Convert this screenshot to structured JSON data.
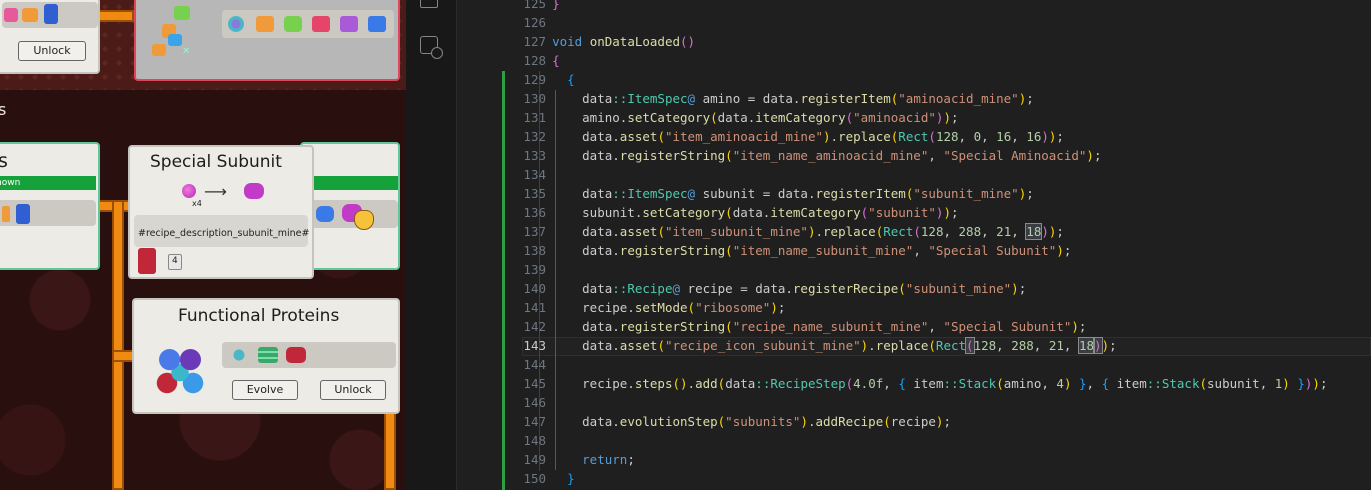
{
  "game": {
    "top_card": {
      "unlock_label": "Unlock"
    },
    "left_header_fragment": "s",
    "left_card": {
      "title_fragment": "s",
      "status_fragment": "nown"
    },
    "special_card": {
      "title": "Special Subunit",
      "multiplier": "x4",
      "description": "#recipe_description_subunit_mine#",
      "stack_count": "4"
    },
    "right_card": {
      "status_fragment": "n"
    },
    "functional_card": {
      "title": "Functional Proteins",
      "evolve_label": "Evolve",
      "unlock_label": "Unlock"
    }
  },
  "editor": {
    "current_line": 143,
    "lines": [
      {
        "n": 125,
        "tokens": [
          [
            "p",
            "  "
          ],
          [
            "b2",
            "}"
          ]
        ]
      },
      {
        "n": 126,
        "tokens": []
      },
      {
        "n": 127,
        "tokens": [
          [
            "p",
            "  "
          ],
          [
            "k",
            "void"
          ],
          [
            "p",
            " "
          ],
          [
            "f",
            "onDataLoaded"
          ],
          [
            "b2",
            "()"
          ]
        ]
      },
      {
        "n": 128,
        "tokens": [
          [
            "p",
            "  "
          ],
          [
            "b2",
            "{"
          ]
        ]
      },
      {
        "n": 129,
        "tokens": [
          [
            "p",
            "    "
          ],
          [
            "b3",
            "{"
          ]
        ]
      },
      {
        "n": 130,
        "tokens": [
          [
            "p",
            "      data"
          ],
          [
            "t",
            "::"
          ],
          [
            "t",
            "ItemSpec"
          ],
          [
            "k",
            "@"
          ],
          [
            "p",
            " amino = data."
          ],
          [
            "f",
            "registerItem"
          ],
          [
            "b1",
            "("
          ],
          [
            "s",
            "\"aminoacid_mine\""
          ],
          [
            "b1",
            ")"
          ],
          [
            "p",
            ";"
          ]
        ]
      },
      {
        "n": 131,
        "tokens": [
          [
            "p",
            "      amino."
          ],
          [
            "f",
            "setCategory"
          ],
          [
            "b1",
            "("
          ],
          [
            "p",
            "data."
          ],
          [
            "f",
            "itemCategory"
          ],
          [
            "b2",
            "("
          ],
          [
            "s",
            "\"aminoacid\""
          ],
          [
            "b2",
            ")"
          ],
          [
            "b1",
            ")"
          ],
          [
            "p",
            ";"
          ]
        ]
      },
      {
        "n": 132,
        "tokens": [
          [
            "p",
            "      data."
          ],
          [
            "f",
            "asset"
          ],
          [
            "b1",
            "("
          ],
          [
            "s",
            "\"item_aminoacid_mine\""
          ],
          [
            "b1",
            ")"
          ],
          [
            "p",
            "."
          ],
          [
            "f",
            "replace"
          ],
          [
            "b1",
            "("
          ],
          [
            "t",
            "Rect"
          ],
          [
            "b2",
            "("
          ],
          [
            "n",
            "128"
          ],
          [
            "p",
            ", "
          ],
          [
            "n",
            "0"
          ],
          [
            "p",
            ", "
          ],
          [
            "n",
            "16"
          ],
          [
            "p",
            ", "
          ],
          [
            "n",
            "16"
          ],
          [
            "b2",
            ")"
          ],
          [
            "b1",
            ")"
          ],
          [
            "p",
            ";"
          ]
        ]
      },
      {
        "n": 133,
        "tokens": [
          [
            "p",
            "      data."
          ],
          [
            "f",
            "registerString"
          ],
          [
            "b1",
            "("
          ],
          [
            "s",
            "\"item_name_aminoacid_mine\""
          ],
          [
            "p",
            ", "
          ],
          [
            "s",
            "\"Special Aminoacid\""
          ],
          [
            "b1",
            ")"
          ],
          [
            "p",
            ";"
          ]
        ]
      },
      {
        "n": 134,
        "tokens": []
      },
      {
        "n": 135,
        "tokens": [
          [
            "p",
            "      data"
          ],
          [
            "t",
            "::"
          ],
          [
            "t",
            "ItemSpec"
          ],
          [
            "k",
            "@"
          ],
          [
            "p",
            " subunit = data."
          ],
          [
            "f",
            "registerItem"
          ],
          [
            "b1",
            "("
          ],
          [
            "s",
            "\"subunit_mine\""
          ],
          [
            "b1",
            ")"
          ],
          [
            "p",
            ";"
          ]
        ]
      },
      {
        "n": 136,
        "tokens": [
          [
            "p",
            "      subunit."
          ],
          [
            "f",
            "setCategory"
          ],
          [
            "b1",
            "("
          ],
          [
            "p",
            "data."
          ],
          [
            "f",
            "itemCategory"
          ],
          [
            "b2",
            "("
          ],
          [
            "s",
            "\"subunit\""
          ],
          [
            "b2",
            ")"
          ],
          [
            "b1",
            ")"
          ],
          [
            "p",
            ";"
          ]
        ]
      },
      {
        "n": 137,
        "tokens": [
          [
            "p",
            "      data."
          ],
          [
            "f",
            "asset"
          ],
          [
            "b1",
            "("
          ],
          [
            "s",
            "\"item_subunit_mine\""
          ],
          [
            "b1",
            ")"
          ],
          [
            "p",
            "."
          ],
          [
            "f",
            "replace"
          ],
          [
            "b1",
            "("
          ],
          [
            "t",
            "Rect"
          ],
          [
            "b2",
            "("
          ],
          [
            "n",
            "128"
          ],
          [
            "p",
            ", "
          ],
          [
            "n",
            "288"
          ],
          [
            "p",
            ", "
          ],
          [
            "n",
            "21"
          ],
          [
            "p",
            ", "
          ],
          [
            "nsel",
            "18"
          ],
          [
            "b2",
            ")"
          ],
          [
            "b1",
            ")"
          ],
          [
            "p",
            ";"
          ]
        ]
      },
      {
        "n": 138,
        "tokens": [
          [
            "p",
            "      data."
          ],
          [
            "f",
            "registerString"
          ],
          [
            "b1",
            "("
          ],
          [
            "s",
            "\"item_name_subunit_mine\""
          ],
          [
            "p",
            ", "
          ],
          [
            "s",
            "\"Special Subunit\""
          ],
          [
            "b1",
            ")"
          ],
          [
            "p",
            ";"
          ]
        ]
      },
      {
        "n": 139,
        "tokens": []
      },
      {
        "n": 140,
        "tokens": [
          [
            "p",
            "      data"
          ],
          [
            "t",
            "::"
          ],
          [
            "t",
            "Recipe"
          ],
          [
            "k",
            "@"
          ],
          [
            "p",
            " recipe = data."
          ],
          [
            "f",
            "registerRecipe"
          ],
          [
            "b1",
            "("
          ],
          [
            "s",
            "\"subunit_mine\""
          ],
          [
            "b1",
            ")"
          ],
          [
            "p",
            ";"
          ]
        ]
      },
      {
        "n": 141,
        "tokens": [
          [
            "p",
            "      recipe."
          ],
          [
            "f",
            "setMode"
          ],
          [
            "b1",
            "("
          ],
          [
            "s",
            "\"ribosome\""
          ],
          [
            "b1",
            ")"
          ],
          [
            "p",
            ";"
          ]
        ]
      },
      {
        "n": 142,
        "tokens": [
          [
            "p",
            "      data."
          ],
          [
            "f",
            "registerString"
          ],
          [
            "b1",
            "("
          ],
          [
            "s",
            "\"recipe_name_subunit_mine\""
          ],
          [
            "p",
            ", "
          ],
          [
            "s",
            "\"Special Subunit\""
          ],
          [
            "b1",
            ")"
          ],
          [
            "p",
            ";"
          ]
        ]
      },
      {
        "n": 143,
        "tokens": [
          [
            "p",
            "      data."
          ],
          [
            "f",
            "asset"
          ],
          [
            "b1",
            "("
          ],
          [
            "s",
            "\"recipe_icon_subunit_mine\""
          ],
          [
            "b1",
            ")"
          ],
          [
            "p",
            "."
          ],
          [
            "f",
            "replace"
          ],
          [
            "b1",
            "("
          ],
          [
            "t",
            "Rect"
          ],
          [
            "b2sel",
            "("
          ],
          [
            "n",
            "128"
          ],
          [
            "p",
            ", "
          ],
          [
            "n",
            "288"
          ],
          [
            "p",
            ", "
          ],
          [
            "n",
            "21"
          ],
          [
            "p",
            ", "
          ],
          [
            "nsel",
            "18"
          ],
          [
            "b2sel",
            ")"
          ],
          [
            "b1",
            ")"
          ],
          [
            "p",
            ";"
          ]
        ]
      },
      {
        "n": 144,
        "tokens": []
      },
      {
        "n": 145,
        "tokens": [
          [
            "p",
            "      recipe."
          ],
          [
            "f",
            "steps"
          ],
          [
            "b1",
            "()"
          ],
          [
            "p",
            "."
          ],
          [
            "f",
            "add"
          ],
          [
            "b1",
            "("
          ],
          [
            "p",
            "data"
          ],
          [
            "t",
            "::"
          ],
          [
            "t",
            "RecipeStep"
          ],
          [
            "b2",
            "("
          ],
          [
            "n",
            "4.0f"
          ],
          [
            "p",
            ", "
          ],
          [
            "b3",
            "{"
          ],
          [
            "p",
            " item"
          ],
          [
            "t",
            "::"
          ],
          [
            "t",
            "Stack"
          ],
          [
            "b1",
            "("
          ],
          [
            "p",
            "amino, "
          ],
          [
            "n",
            "4"
          ],
          [
            "b1",
            ")"
          ],
          [
            "p",
            " "
          ],
          [
            "b3",
            "}"
          ],
          [
            "p",
            ", "
          ],
          [
            "b3",
            "{"
          ],
          [
            "p",
            " item"
          ],
          [
            "t",
            "::"
          ],
          [
            "t",
            "Stack"
          ],
          [
            "b1",
            "("
          ],
          [
            "p",
            "subunit, "
          ],
          [
            "n",
            "1"
          ],
          [
            "b1",
            ")"
          ],
          [
            "p",
            " "
          ],
          [
            "b3",
            "}"
          ],
          [
            "b2",
            ")"
          ],
          [
            "b1",
            ")"
          ],
          [
            "p",
            ";"
          ]
        ]
      },
      {
        "n": 146,
        "tokens": []
      },
      {
        "n": 147,
        "tokens": [
          [
            "p",
            "      data."
          ],
          [
            "f",
            "evolutionStep"
          ],
          [
            "b1",
            "("
          ],
          [
            "s",
            "\"subunits\""
          ],
          [
            "b1",
            ")"
          ],
          [
            "p",
            "."
          ],
          [
            "f",
            "addRecipe"
          ],
          [
            "b1",
            "("
          ],
          [
            "p",
            "recipe"
          ],
          [
            "b1",
            ")"
          ],
          [
            "p",
            ";"
          ]
        ]
      },
      {
        "n": 148,
        "tokens": []
      },
      {
        "n": 149,
        "tokens": [
          [
            "p",
            "      "
          ],
          [
            "k",
            "return"
          ],
          [
            "p",
            ";"
          ]
        ]
      },
      {
        "n": 150,
        "tokens": [
          [
            "p",
            "    "
          ],
          [
            "b3",
            "}"
          ]
        ]
      }
    ]
  }
}
